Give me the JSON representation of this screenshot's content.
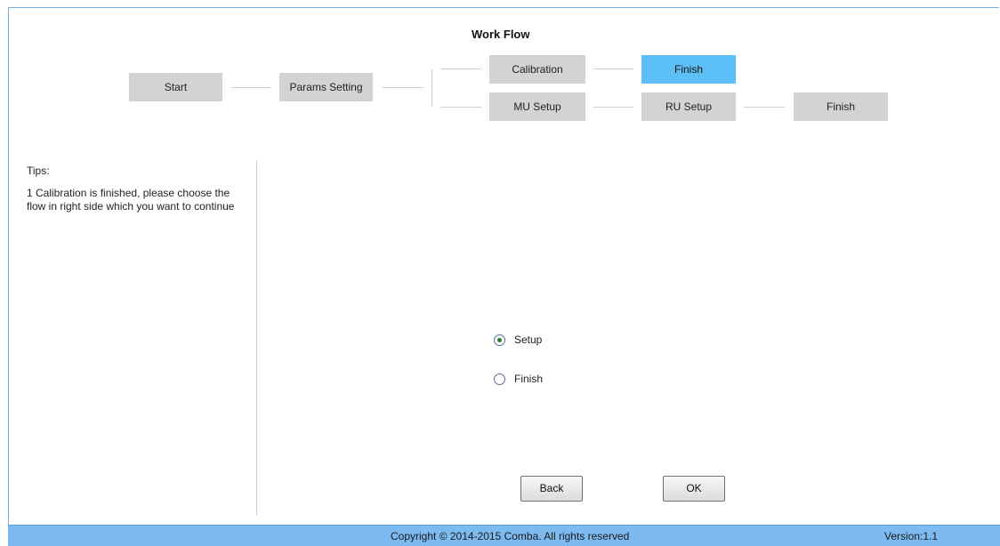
{
  "workflow": {
    "title": "Work Flow",
    "steps": {
      "start": "Start",
      "params": "Params Setting",
      "calibration": "Calibration",
      "finish_top": "Finish",
      "mu_setup": "MU Setup",
      "ru_setup": "RU Setup",
      "finish_bottom": "Finish"
    },
    "active_step": "finish_top",
    "active_color": "#5cc0f7",
    "inactive_color": "#d3d3d3"
  },
  "tips": {
    "title": "Tips:",
    "text": "1 Calibration is finished, please choose the flow in right side which you want to continue"
  },
  "options": {
    "selected": "setup",
    "setup_label": "Setup",
    "finish_label": "Finish"
  },
  "buttons": {
    "back": "Back",
    "ok": "OK"
  },
  "footer": {
    "copyright": "Copyright © 2014-2015 Comba. All rights reserved",
    "version": "Version:1.1"
  }
}
